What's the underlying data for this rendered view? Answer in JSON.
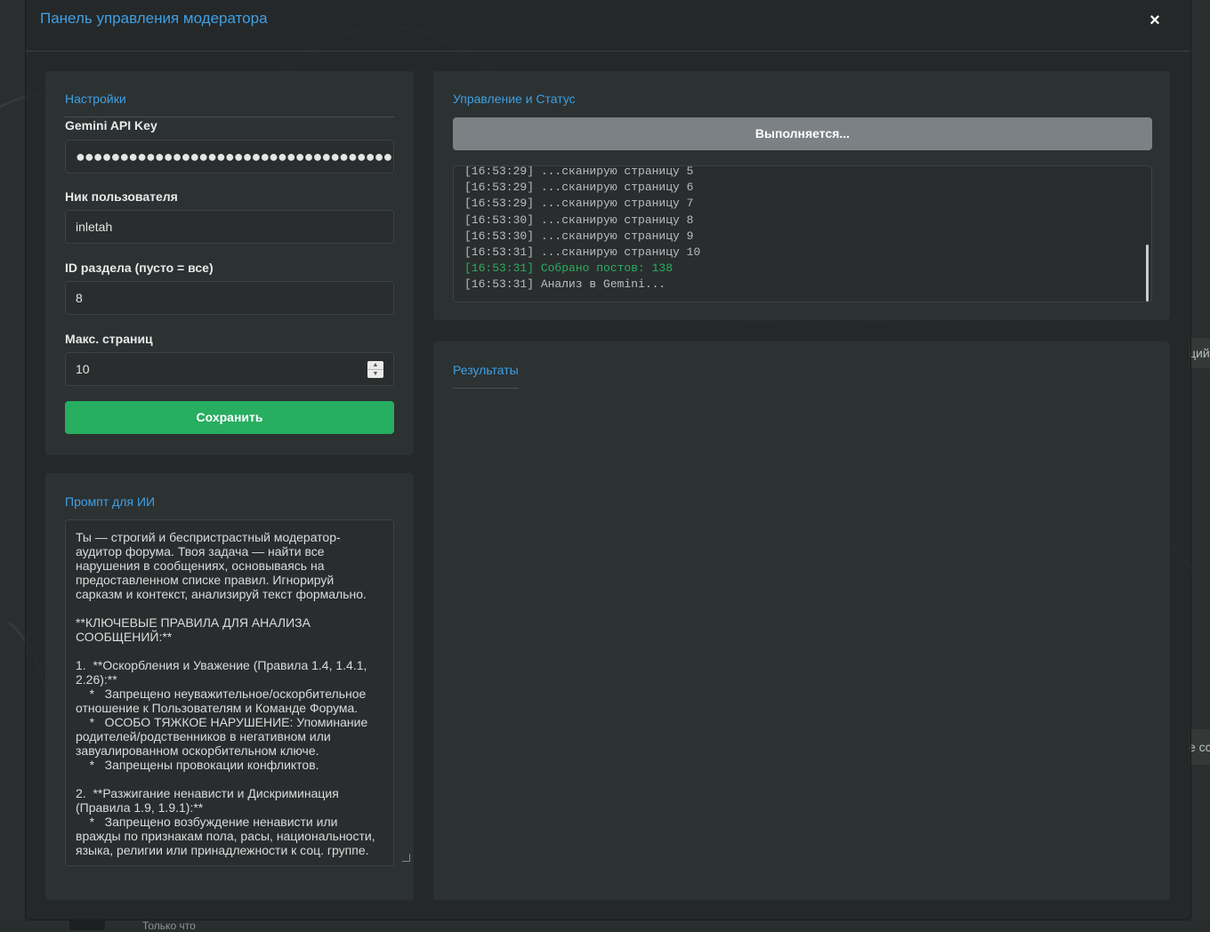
{
  "modal": {
    "title": "Панель управления модератора",
    "close_icon": "×"
  },
  "settings": {
    "title": "Настройки",
    "api_key_label": "Gemini API Key",
    "api_key_value": "●●●●●●●●●●●●●●●●●●●●●●●●●●●●●●●●●●●●●●",
    "nick_label": "Ник пользователя",
    "nick_value": "inletah",
    "section_label": "ID раздела (пусто = все)",
    "section_value": "8",
    "max_pages_label": "Макс. страниц",
    "max_pages_value": "10",
    "save_label": "Сохранить"
  },
  "prompt": {
    "title": "Промпт для ИИ",
    "text": "Ты — строгий и беспристрастный модератор-аудитор форума. Твоя задача — найти все нарушения в сообщениях, основываясь на предоставленном списке правил. Игнорируй сарказм и контекст, анализируй текст формально.\n\n**КЛЮЧЕВЫЕ ПРАВИЛА ДЛЯ АНАЛИЗА СООБЩЕНИЙ:**\n\n1.  **Оскорбления и Уважение (Правила 1.4, 1.4.1, 2.26):**\n    *   Запрещено неуважительное/оскорбительное отношение к Пользователям и Команде Форума.\n    *   ОСОБО ТЯЖКОЕ НАРУШЕНИЕ: Упоминание родителей/родственников в негативном или завуалированном оскорбительном ключе.\n    *   Запрещены провокации конфликтов.\n\n2.  **Разжигание ненависти и Дискриминация (Правила 1.9, 1.9.1):**\n    *   Запрещено возбуждение ненависти или вражды по признакам пола, расы, национальности, языка, религии или принадлежности к соц. группе."
  },
  "control": {
    "title": "Управление и Статус",
    "running_label": "Выполняется...",
    "log": [
      {
        "text": "[16:53:29] ...сканирую страницу 5",
        "status": "normal"
      },
      {
        "text": "[16:53:29] ...сканирую страницу 6",
        "status": "normal"
      },
      {
        "text": "[16:53:29] ...сканирую страницу 7",
        "status": "normal"
      },
      {
        "text": "[16:53:30] ...сканирую страницу 8",
        "status": "normal"
      },
      {
        "text": "[16:53:30] ...сканирую страницу 9",
        "status": "normal"
      },
      {
        "text": "[16:53:31] ...сканирую страницу 10",
        "status": "normal"
      },
      {
        "text": "[16:53:31] Собрано постов: 138",
        "status": "success"
      },
      {
        "text": "[16:53:31] Анализ в Gemini...",
        "status": "normal"
      }
    ]
  },
  "results": {
    "title": "Результаты"
  },
  "background": {
    "peek_text_1": "ций",
    "peek_text_2": "е сс",
    "bottom_text": "Только что"
  },
  "colors": {
    "accent": "#3ea0e6",
    "success": "#27ae60",
    "muted_button": "#7b8184"
  }
}
